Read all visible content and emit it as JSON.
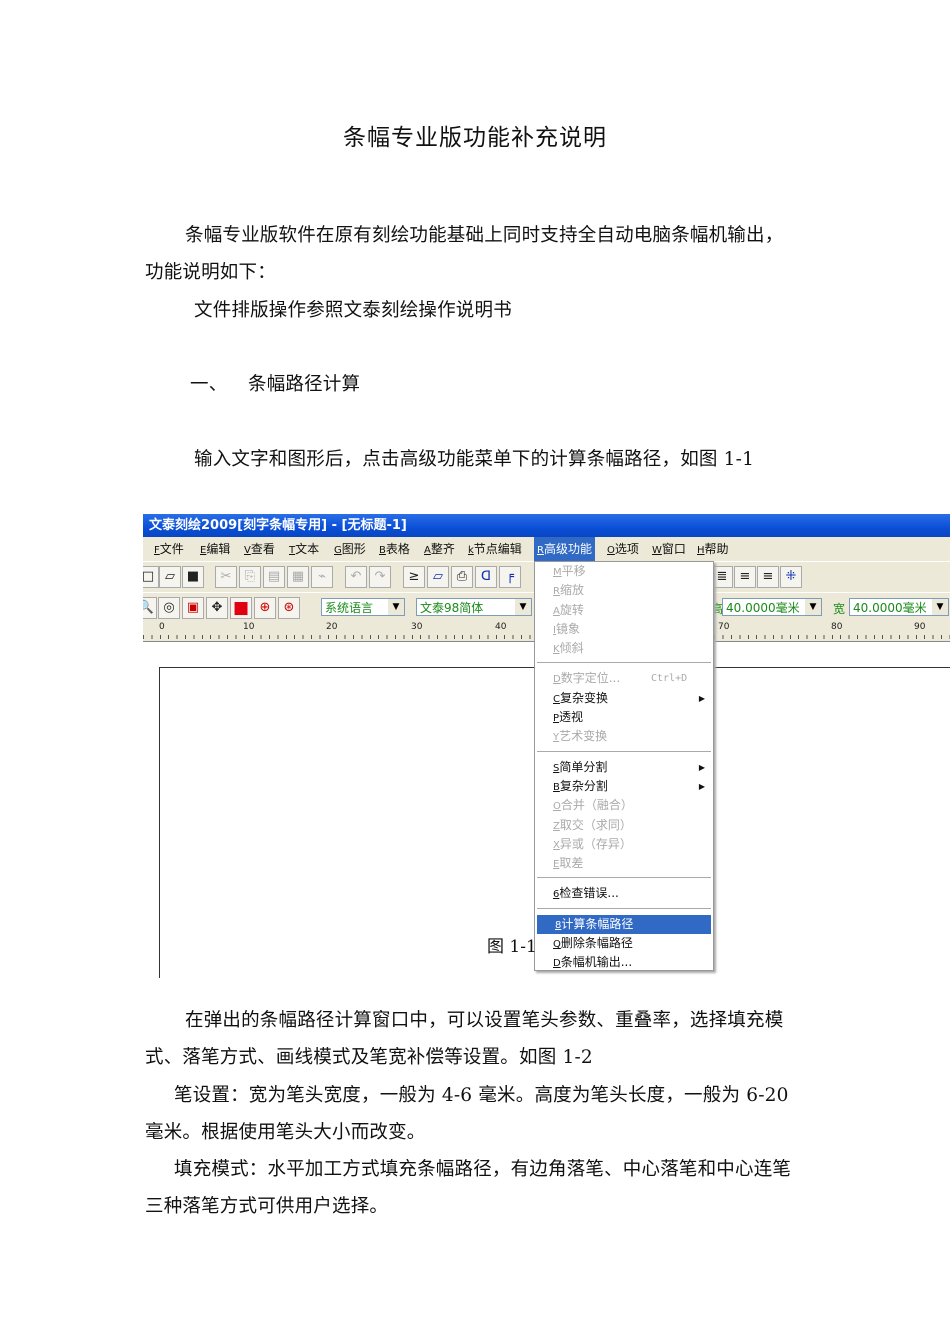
{
  "title": "条幅专业版功能补充说明",
  "paragraphs": {
    "p1_l1": "条幅专业版软件在原有刻绘功能基础上同时支持全自动电脑条幅机输出，",
    "p1_l2": "功能说明如下：",
    "p2": "文件排版操作参照文泰刻绘操作说明书",
    "section_num": "一、",
    "section_title": "条幅路径计算",
    "p3": "输入文字和图形后，点击高级功能菜单下的计算条幅路径，如图 1-1",
    "caption": "图 1-1",
    "p4_l1": "在弹出的条幅路径计算窗口中，可以设置笔头参数、重叠率，选择填充模",
    "p4_l2": "式、落笔方式、画线模式及笔宽补偿等设置。如图 1-2",
    "p5_l1": "笔设置：宽为笔头宽度，一般为 4-6 毫米。高度为笔头长度，一般为 6-20",
    "p5_l2": "毫米。根据使用笔头大小而改变。",
    "p6_l1": "填充模式：水平加工方式填充条幅路径，有边角落笔、中心落笔和中心连笔",
    "p6_l2": "三种落笔方式可供用户选择。"
  },
  "screenshot": {
    "window_title": "文泰刻绘2009[刻字条幅专用] - [无标题-1]",
    "menu": [
      {
        "key": "F",
        "label": "文件"
      },
      {
        "key": "E",
        "label": "编辑"
      },
      {
        "key": "V",
        "label": "查看"
      },
      {
        "key": "T",
        "label": "文本"
      },
      {
        "key": "G",
        "label": "图形"
      },
      {
        "key": "B",
        "label": "表格"
      },
      {
        "key": "A",
        "label": "整齐"
      },
      {
        "key": "k",
        "label": "节点编辑"
      },
      {
        "key": "R",
        "label": "高级功能"
      },
      {
        "key": "O",
        "label": "选项"
      },
      {
        "key": "W",
        "label": "窗口"
      },
      {
        "key": "H",
        "label": "帮助"
      }
    ],
    "font_lang": "系统语言",
    "font_name": "文泰98简体",
    "height_label": "高",
    "height_value": "40.0000毫米",
    "width_label": "宽",
    "width_value": "40.0000毫米",
    "ruler": [
      "0",
      "10",
      "20",
      "30",
      "40",
      "70",
      "80",
      "90"
    ],
    "dropdown": [
      {
        "key": "M",
        "label": "平移",
        "disabled": true
      },
      {
        "key": "R",
        "label": "缩放",
        "disabled": true
      },
      {
        "key": "A",
        "label": "旋转",
        "disabled": true
      },
      {
        "key": "I",
        "label": "镜象",
        "disabled": true
      },
      {
        "key": "K",
        "label": "倾斜",
        "disabled": true
      },
      {
        "sep": true
      },
      {
        "key": "D",
        "label": "数字定位...",
        "disabled": true,
        "shortcut": "Ctrl+D"
      },
      {
        "key": "C",
        "label": "复杂变换",
        "submenu": true
      },
      {
        "key": "P",
        "label": "透视"
      },
      {
        "key": "Y",
        "label": "艺术变换",
        "disabled": true
      },
      {
        "sep": true
      },
      {
        "key": "S",
        "label": "简单分割",
        "submenu": true
      },
      {
        "key": "B",
        "label": "复杂分割",
        "submenu": true
      },
      {
        "key": "O",
        "label": "合并（融合）",
        "disabled": true
      },
      {
        "key": "Z",
        "label": "取交（求同）",
        "disabled": true
      },
      {
        "key": "X",
        "label": "异或（存异）",
        "disabled": true
      },
      {
        "key": "E",
        "label": "取差",
        "disabled": true
      },
      {
        "sep": true
      },
      {
        "key": "6",
        "label": "检查错误..."
      },
      {
        "sep": true
      },
      {
        "key": "8",
        "label": "计算条幅路径",
        "selected": true
      },
      {
        "key": "Q",
        "label": "删除条幅路径"
      },
      {
        "key": "D",
        "label": "条幅机输出..."
      }
    ]
  }
}
